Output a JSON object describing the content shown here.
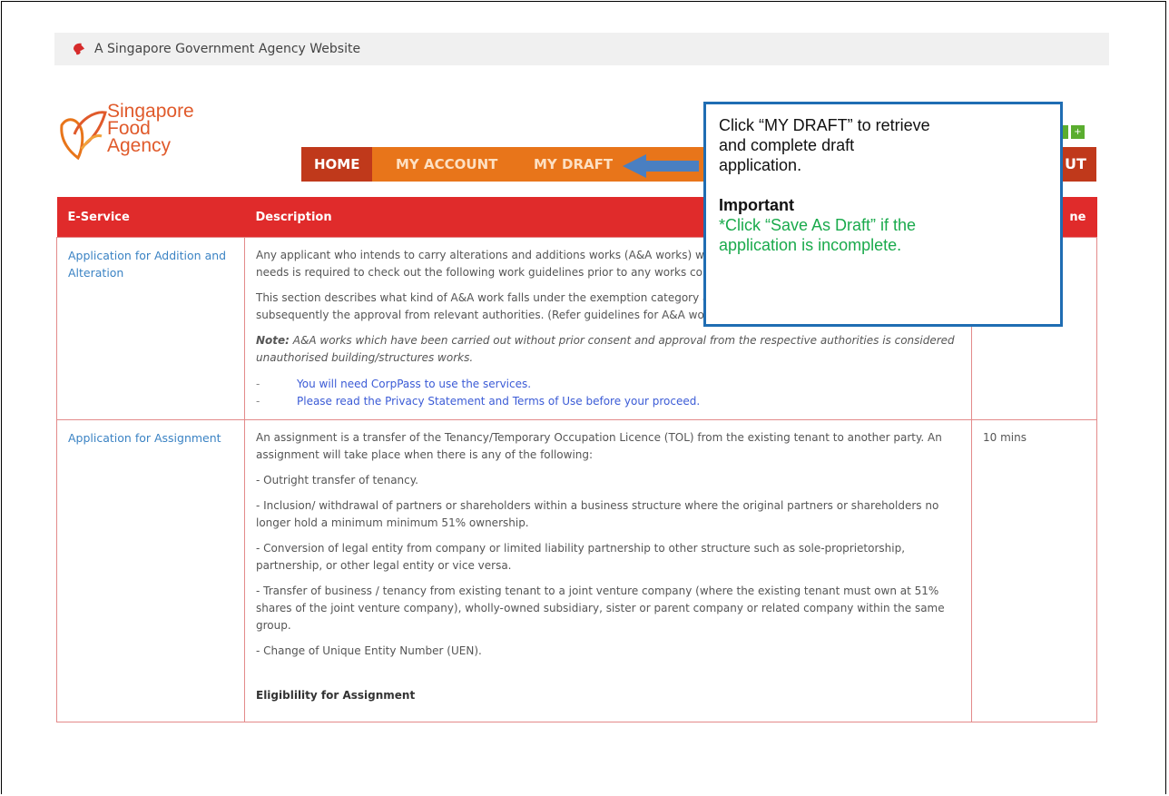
{
  "gov_banner": {
    "text": "A Singapore Government Agency Website"
  },
  "logo": {
    "line1": "Singapore",
    "line2": "Food",
    "line3": "Agency"
  },
  "nav": {
    "home": "HOME",
    "my_account": "MY ACCOUNT",
    "my_draft": "MY DRAFT",
    "logout_partial": "UT"
  },
  "table": {
    "headers": [
      "E-Service",
      "Description",
      "ne"
    ],
    "rows": [
      {
        "name": "Application for Addition and Alteration",
        "paragraphs": [
          "Any applicant who intends to carry alterations and additions works (A&A works) wit",
          "needs is required to check out the following work guidelines prior to any works com",
          "This section describes what kind of A&A work falls under the exemption category ar",
          "subsequently the approval from relevant authorities. (Refer guidelines for A&A work"
        ],
        "note_label": "Note:",
        "note_text": "A&A works which have been carried out without prior consent and approval from the respective authorities is considered unauthorised building/structures works.",
        "links": [
          "You will need CorpPass to use the services.",
          "Please read the Privacy Statement and Terms of Use before your proceed."
        ],
        "time": ""
      },
      {
        "name": "Application for Assignment",
        "paragraphs": [
          "An assignment is a transfer of the Tenancy/Temporary Occupation Licence (TOL) from the existing tenant to another party. An assignment will take place when there is any of the following:",
          "- Outright transfer of tenancy.",
          "- Inclusion/ withdrawal of partners or shareholders within a business structure where the original partners or shareholders no longer hold a minimum minimum 51% ownership.",
          "- Conversion of legal entity from company or limited liability partnership to other structure such as sole-proprietorship, partnership, or other legal entity or vice versa.",
          "- Transfer of business / tenancy from existing tenant to a joint venture company (where the existing tenant must own at 51% shares of the joint venture company), wholly-owned subsidiary, sister or parent company or related company within the same group.",
          "- Change of Unique Entity Number (UEN)."
        ],
        "eligibility": "Eligiblility for Assignment",
        "time": "10 mins"
      }
    ]
  },
  "callout": {
    "line1": "Click “MY DRAFT” to retrieve",
    "line2": "and complete draft",
    "line3": "application.",
    "important": "Important",
    "green1": "*Click “Save As Draft” if the",
    "green2": "application is incomplete."
  },
  "colors": {
    "nav_orange": "#e8751a",
    "nav_red": "#c0391b",
    "table_header": "#e02b2b",
    "callout_border": "#1f6db3",
    "green_text": "#1aaa4c"
  }
}
